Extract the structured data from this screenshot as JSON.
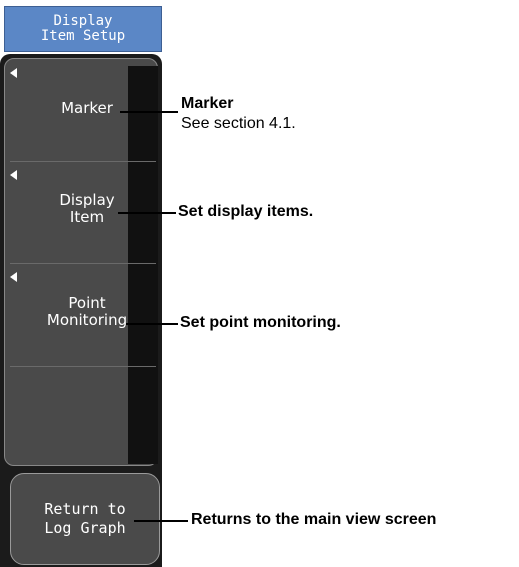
{
  "menu": {
    "title": "Display\nItem Setup",
    "softkeys": [
      {
        "label": "Marker"
      },
      {
        "label": "Display\nItem"
      },
      {
        "label": "Point\nMonitoring"
      }
    ],
    "return_key": "Return to\nLog Graph"
  },
  "callouts": {
    "marker_title": "Marker",
    "marker_note": "See section 4.1.",
    "display_item": "Set display items.",
    "point_monitoring": "Set point monitoring.",
    "return": "Returns to the main view screen"
  },
  "colors": {
    "header_bg": "#5b87c6",
    "key_bg": "#4a4a4a",
    "panel_bg": "#1b1b1b",
    "text_on_key": "#ffffff"
  }
}
